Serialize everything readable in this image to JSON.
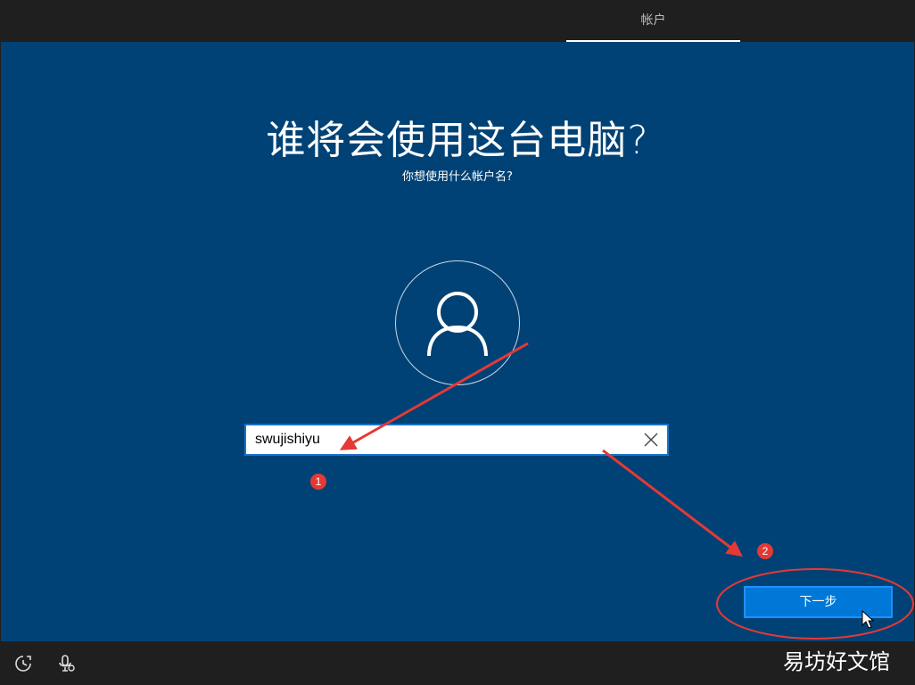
{
  "topbar": {
    "tab_label": "帐户"
  },
  "main": {
    "title": "谁将会使用这台电脑?",
    "subtitle": "你想使用什么帐户名?",
    "username_value": "swujishiyu",
    "next_label": "下一步"
  },
  "annotations": {
    "badge_1": "1",
    "badge_2": "2"
  },
  "watermark": "易坊好文馆",
  "colors": {
    "background": "#004275",
    "button": "#0078d7",
    "annotation_red": "#e53935"
  },
  "icons": {
    "avatar": "user-icon",
    "clear": "close-icon",
    "ease_of_access": "ease-of-access-icon",
    "microphone": "microphone-icon"
  }
}
